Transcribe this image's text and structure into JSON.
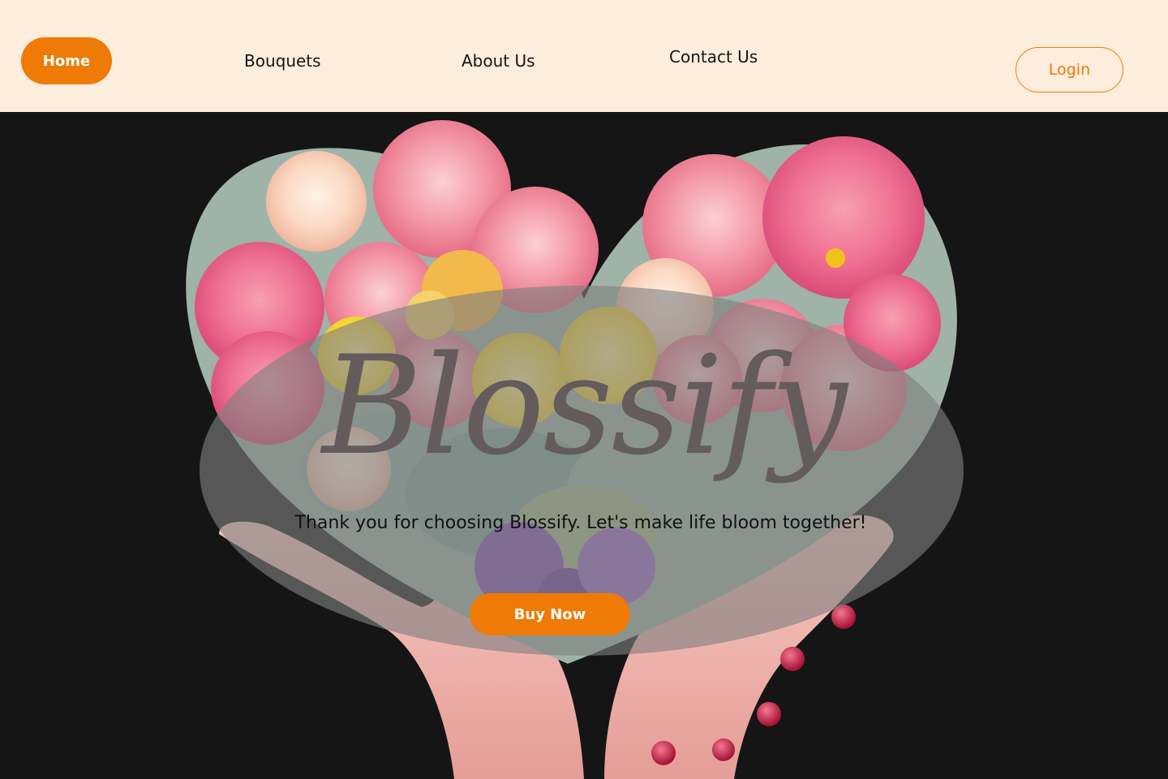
{
  "nav": {
    "home_label": "Home",
    "bouquets_label": "Bouquets",
    "about_label": "About Us",
    "contact_label": "Contact Us",
    "login_label": "Login"
  },
  "hero": {
    "brand": "Blossify",
    "tagline": "Thank you for choosing Blossify. Let's make life bloom together!",
    "cta_label": "Buy Now",
    "image_icon": "heart-of-flowers-held-in-hands"
  },
  "colors": {
    "accent": "#ef7a06",
    "nav_background": "#fdeddc",
    "page_background": "#151515",
    "brand_text": "#635b5c"
  }
}
